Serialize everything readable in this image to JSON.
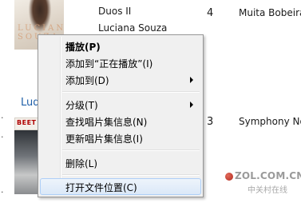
{
  "library": {
    "row1": {
      "album": "Duos II",
      "artist": "Luciana Souza",
      "track_no": "4",
      "title": "Muita Bobeira"
    },
    "row2": {
      "artist_partial": "Lud",
      "track_no": "3",
      "title": "Symphony No"
    },
    "art1_letters": "LUCIANA SOUZA",
    "art2_text": "BEET"
  },
  "context_menu": {
    "items": [
      {
        "label": "播放(P)"
      },
      {
        "label": "添加到“正在播放”(I)"
      },
      {
        "label": "添加到(D)"
      },
      {
        "label": "分级(T)"
      },
      {
        "label": "查找唱片集信息(N)"
      },
      {
        "label": "更新唱片集信息(I)"
      },
      {
        "label": "删除(L)"
      },
      {
        "label": "打开文件位置(C)"
      }
    ]
  },
  "watermark": {
    "text": "ZOL.COM.CN",
    "subtext": "中关村在线"
  },
  "colors": {
    "menu_bg": "#f0f0f0",
    "highlight_border": "#aecff7",
    "link_blue": "#1f5fa8"
  }
}
